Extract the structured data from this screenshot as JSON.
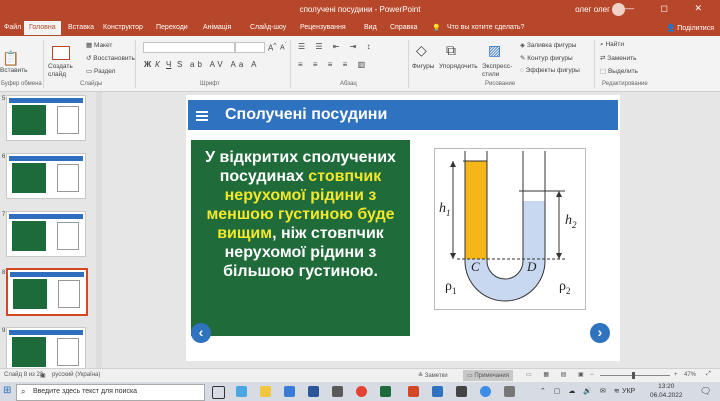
{
  "window": {
    "title": "сполучені посудини - PowerPoint",
    "user": "олег олег",
    "controls": "—  ◻  ✕"
  },
  "tabs": [
    {
      "label": "Файл",
      "active": false
    },
    {
      "label": "Головна",
      "active": true
    },
    {
      "label": "Вставка",
      "active": false
    },
    {
      "label": "Конструктор",
      "active": false
    },
    {
      "label": "Переходи",
      "active": false
    },
    {
      "label": "Анімація",
      "active": false
    },
    {
      "label": "Слайд-шоу",
      "active": false
    },
    {
      "label": "Рецензування",
      "active": false
    },
    {
      "label": "Вид",
      "active": false
    },
    {
      "label": "Справка",
      "active": false
    }
  ],
  "tell_me": "Что вы хотите сделать?",
  "share_label": "Поділитися",
  "ribbon": {
    "paste": "Вставить",
    "new_slide": "Создать слайд",
    "layout": "Макет",
    "reset": "Восстановить",
    "section": "Раздел",
    "format_bold": "Ж",
    "format_italic": "К",
    "format_underline": "Ч",
    "format_strike": "S",
    "font_size_up": "A",
    "font_size_down": "A",
    "shapes": "Фигуры",
    "arrange": "Упорядочить",
    "quick_styles": "Экспресс-стили",
    "shape_fill": "Заливка фигуры",
    "shape_outline": "Контур фигуры",
    "shape_effects": "Эффекты фигуры",
    "find": "Найти",
    "replace": "Заменить",
    "select": "Выделить",
    "groups": {
      "clipboard": "Буфер обмена",
      "slides": "Слайды",
      "font": "Шрифт",
      "paragraph": "Абзац",
      "drawing": "Рисование",
      "editing": "Редактирование"
    }
  },
  "thumbnails": [
    {
      "num": "5"
    },
    {
      "num": "6"
    },
    {
      "num": "7"
    },
    {
      "num": "8",
      "selected": true
    },
    {
      "num": "9"
    }
  ],
  "slide": {
    "title": "Сполучені посудини",
    "text_parts": {
      "p1": "У відкритих сполучених посудинах ",
      "p2": "стовпчик нерухомої рідини з меншою густиною буде вищим",
      "p3": ", ніж стовпчик нерухомої рідини з більшою густиною."
    },
    "figure": {
      "h1": "h",
      "h1_sub": "1",
      "h2": "h",
      "h2_sub": "2",
      "c": "C",
      "d": "D",
      "rho1": "ρ",
      "rho1_sub": "1",
      "rho2": "ρ",
      "rho2_sub": "2"
    },
    "prev": "‹",
    "next": "›"
  },
  "status": {
    "slide_info": "Слайд 8 из 23",
    "language": "русский (Україна)",
    "notes": "Заметки",
    "comments": "Примечания",
    "zoom": "47%"
  },
  "taskbar": {
    "search_placeholder": "Введите здесь текст для поиска",
    "lang": "УКР",
    "time": "13:20",
    "date": "06.04.2022"
  },
  "colors": {
    "accent": "#b7472a",
    "slide_header": "#2f72c0",
    "text_box": "#1f6b3a",
    "highlight": "#f3e82b",
    "liquid_light": "#f5b61a",
    "liquid_heavy": "#c8d8f0"
  }
}
